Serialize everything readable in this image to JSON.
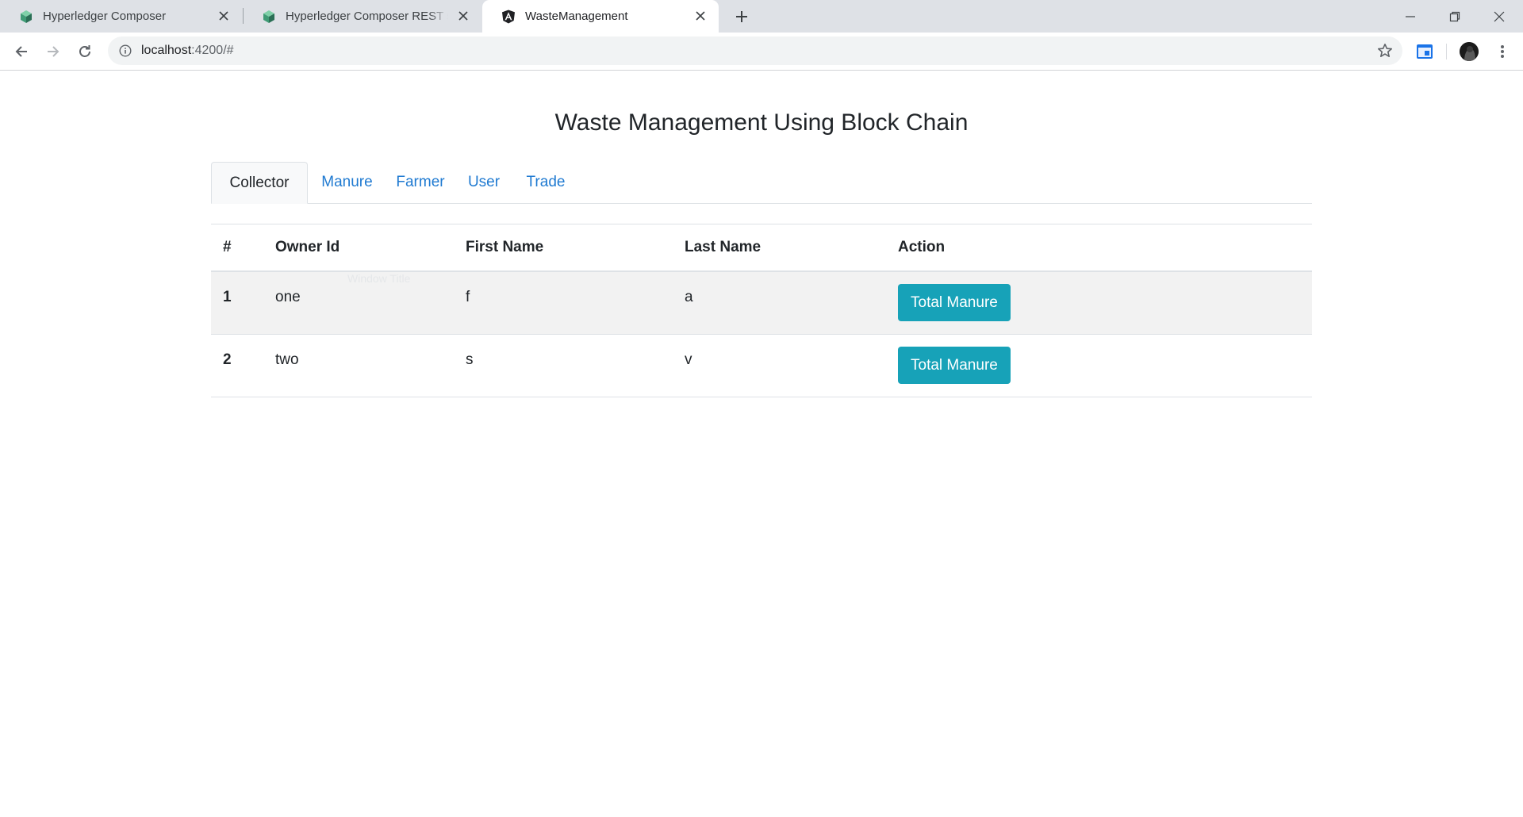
{
  "browser": {
    "tabs": [
      {
        "title": "Hyperledger Composer",
        "icon": "cube-icon"
      },
      {
        "title": "Hyperledger Composer REST server",
        "icon": "cube-icon"
      },
      {
        "title": "WasteManagement",
        "icon": "angular-icon",
        "active": true
      }
    ],
    "url_host": "localhost",
    "url_path": ":4200/#"
  },
  "page": {
    "title": "Waste Management Using Block Chain",
    "tabs": [
      "Collector",
      "Manure",
      "Farmer",
      "User",
      "Trade"
    ],
    "active_tab": "Collector",
    "ghost_text": "Window Title",
    "table": {
      "headers": [
        "#",
        "Owner Id",
        "First Name",
        "Last Name",
        "Action"
      ],
      "rows": [
        {
          "num": "1",
          "owner_id": "one",
          "first_name": "f",
          "last_name": "a",
          "action": "Total Manure"
        },
        {
          "num": "2",
          "owner_id": "two",
          "first_name": "s",
          "last_name": "v",
          "action": "Total Manure"
        }
      ]
    }
  },
  "colors": {
    "accent": "#17a2b8",
    "link": "#1f7ad1",
    "stripe": "#f2f2f2"
  }
}
